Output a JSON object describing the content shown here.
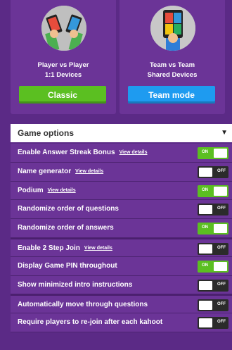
{
  "modes": {
    "classic": {
      "line1": "Player vs Player",
      "line2": "1:1 Devices",
      "button": "Classic",
      "art_icon": "hands-with-phones-icon"
    },
    "team": {
      "line1": "Team vs Team",
      "line2": "Shared Devices",
      "button": "Team mode",
      "art_icon": "hand-with-phone-icon"
    }
  },
  "options_header": "Game options",
  "view_details": "View details",
  "options": [
    {
      "label": "Enable Answer Streak Bonus",
      "details": true,
      "state": "ON"
    },
    {
      "label": "Name generator",
      "details": true,
      "state": "OFF"
    },
    {
      "label": "Podium",
      "details": true,
      "state": "ON"
    },
    {
      "label": "Randomize order of questions",
      "details": false,
      "state": "OFF"
    },
    {
      "label": "Randomize order of answers",
      "details": false,
      "state": "ON"
    },
    {
      "label": "Enable 2 Step Join",
      "details": true,
      "state": "OFF"
    },
    {
      "label": "Display Game PIN throughout",
      "details": false,
      "state": "ON"
    },
    {
      "label": "Show minimized intro instructions",
      "details": false,
      "state": "OFF"
    },
    {
      "label": "Automatically move through questions",
      "details": false,
      "state": "OFF"
    },
    {
      "label": "Require players to re-join after each kahoot",
      "details": false,
      "state": "OFF"
    }
  ],
  "colors": {
    "background": "#5b2a86",
    "card": "#6b3497",
    "classic_button": "#5bbf21",
    "team_button": "#1e9bf0",
    "toggle_on": "#5bbf21",
    "toggle_off": "#2b2b2b"
  }
}
